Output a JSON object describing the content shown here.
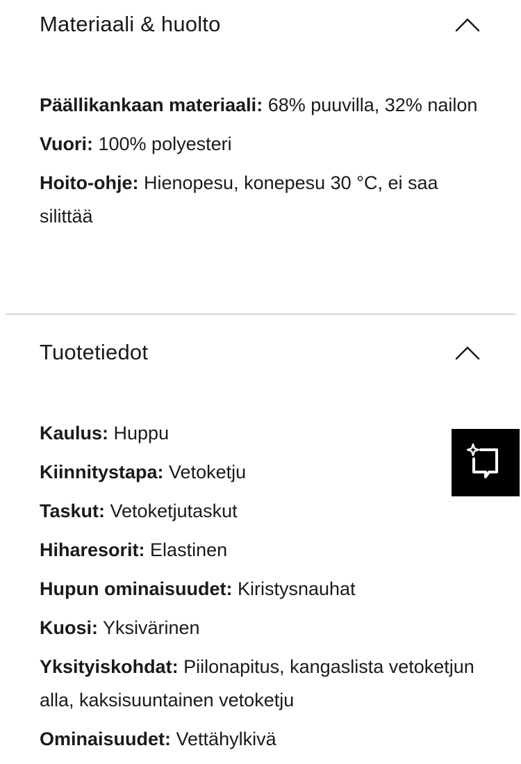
{
  "sections": [
    {
      "title": "Materiaali & huolto",
      "toggle_icon": "chevron-up-icon",
      "attributes": [
        {
          "key": "Päällikankaan materiaali:",
          "value": " 68% puuvilla, 32% nailon"
        },
        {
          "key": "Vuori:",
          "value": " 100% polyesteri"
        },
        {
          "key": "Hoito-ohje:",
          "value": " Hienopesu, konepesu 30 °C, ei saa silittää"
        }
      ]
    },
    {
      "title": "Tuotetiedot",
      "toggle_icon": "chevron-up-icon",
      "attributes": [
        {
          "key": "Kaulus:",
          "value": " Huppu"
        },
        {
          "key": "Kiinnitystapa:",
          "value": " Vetoketju"
        },
        {
          "key": "Taskut:",
          "value": " Vetoketjutaskut"
        },
        {
          "key": "Hiharesorit:",
          "value": " Elastinen"
        },
        {
          "key": "Hupun ominaisuudet:",
          "value": " Kiristysnauhat"
        },
        {
          "key": "Kuosi:",
          "value": " Yksivärinen"
        },
        {
          "key": "Yksityiskohdat:",
          "value": " Piilonapitus, kangaslista vetoketjun alla, kaksisuuntainen vetoketju"
        },
        {
          "key": "Ominaisuudet:",
          "value": " Vettähylkivä"
        }
      ]
    }
  ],
  "floating_button": {
    "icon": "sparkle-crop-icon"
  },
  "colors": {
    "text": "#1a1a1a",
    "divider": "#d8d8d8",
    "fab_bg": "#000000",
    "fab_icon": "#ffffff"
  }
}
